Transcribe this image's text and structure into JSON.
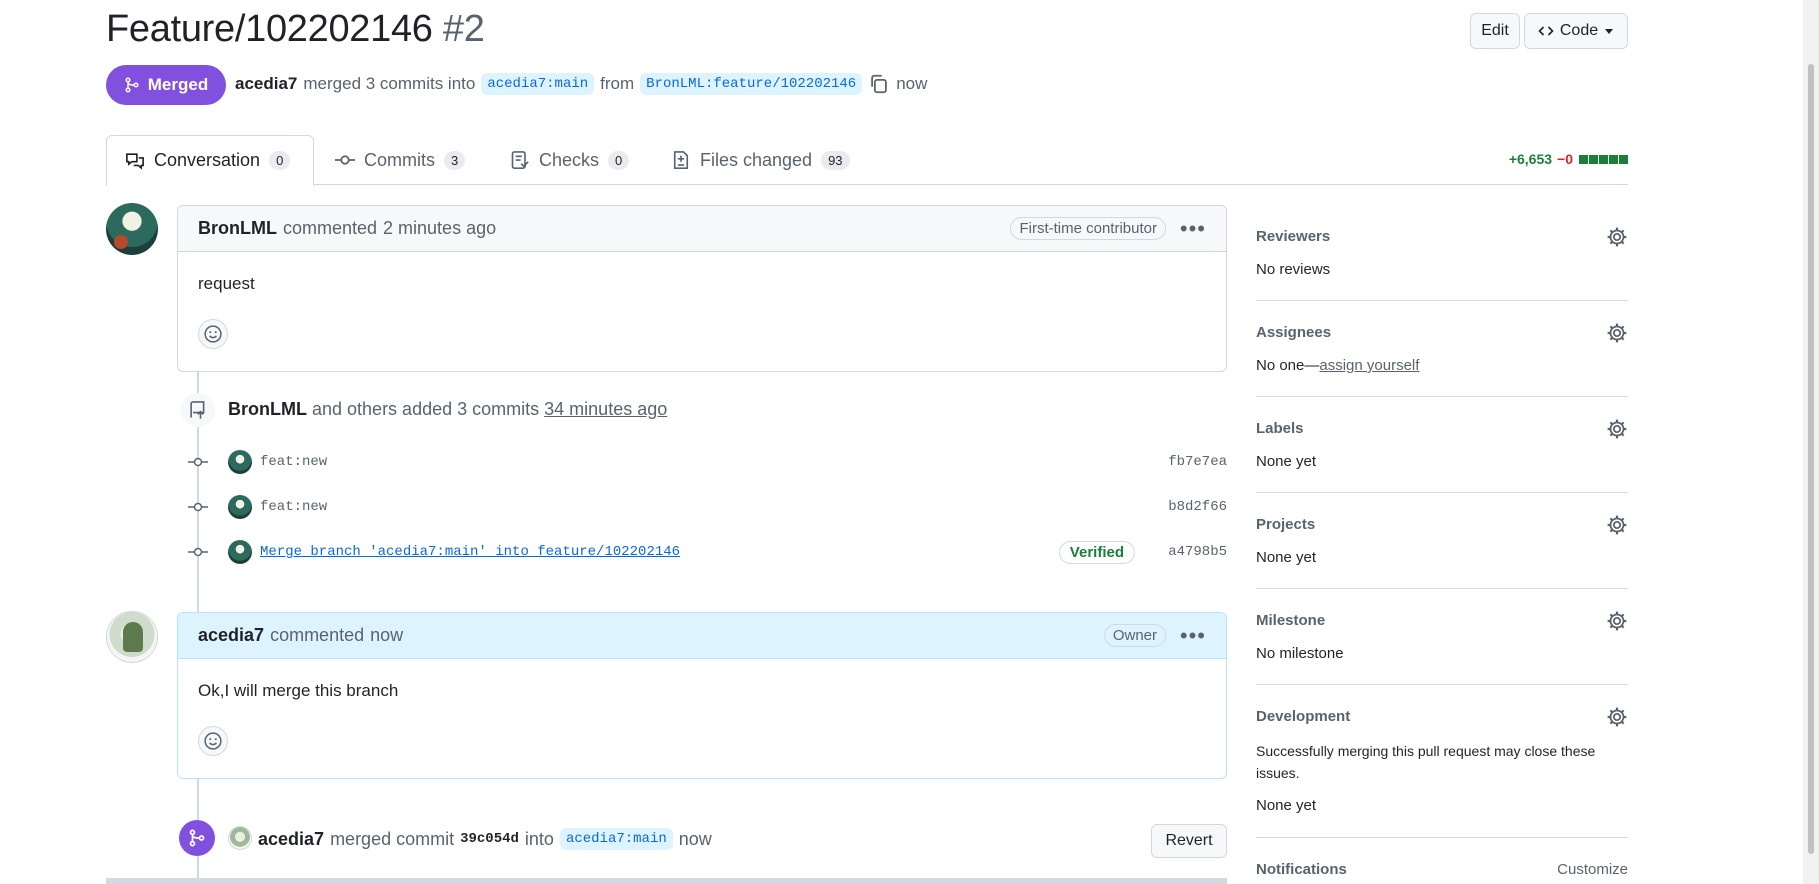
{
  "pr": {
    "title": "Feature/102202146",
    "number": "#2",
    "status": "Merged",
    "author": "acedia7",
    "merge_text": "merged 3 commits into",
    "base_branch": "acedia7:main",
    "from_text": "from",
    "head_branch": "BronLML:feature/102202146",
    "time": "now"
  },
  "header_buttons": {
    "edit": "Edit",
    "code": "Code"
  },
  "tabs": [
    {
      "label": "Conversation",
      "count": "0",
      "icon": "comment-discussion-icon"
    },
    {
      "label": "Commits",
      "count": "3",
      "icon": "git-commit-icon"
    },
    {
      "label": "Checks",
      "count": "0",
      "icon": "checklist-icon"
    },
    {
      "label": "Files changed",
      "count": "93",
      "icon": "file-diff-icon"
    }
  ],
  "diffstat": {
    "additions": "+6,653",
    "deletions": "−0"
  },
  "comments": [
    {
      "author": "BronLML",
      "action": "commented",
      "time": "2 minutes ago",
      "role": "First-time contributor",
      "body": "request"
    },
    {
      "author": "acedia7",
      "action": "commented",
      "time": "now",
      "role": "Owner",
      "body": "Ok,I will merge this branch"
    }
  ],
  "commits_event": {
    "author": "BronLML",
    "text": "and others added 3 commits",
    "time": "34 minutes ago"
  },
  "commits": [
    {
      "message": "feat:new",
      "sha": "fb7e7ea",
      "verified": ""
    },
    {
      "message": "feat:new",
      "sha": "b8d2f66",
      "verified": ""
    },
    {
      "message": "Merge branch 'acedia7:main' into feature/102202146",
      "sha": "a4798b5",
      "verified": "Verified"
    }
  ],
  "merge_event": {
    "author": "acedia7",
    "text": "merged commit",
    "sha": "39c054d",
    "into": "into",
    "branch": "acedia7:main",
    "time": "now",
    "revert": "Revert"
  },
  "sidebar": {
    "reviewers": {
      "title": "Reviewers",
      "value": "No reviews"
    },
    "assignees": {
      "title": "Assignees",
      "value": "No one—",
      "link": "assign yourself"
    },
    "labels": {
      "title": "Labels",
      "value": "None yet"
    },
    "projects": {
      "title": "Projects",
      "value": "None yet"
    },
    "milestone": {
      "title": "Milestone",
      "value": "No milestone"
    },
    "development": {
      "title": "Development",
      "desc": "Successfully merging this pull request may close these issues.",
      "value": "None yet"
    },
    "notifications": {
      "title": "Notifications",
      "action": "Customize"
    }
  },
  "colors": {
    "merged": "#8250df",
    "link": "#0969da",
    "success": "#1a7f37",
    "danger": "#d1242f"
  }
}
